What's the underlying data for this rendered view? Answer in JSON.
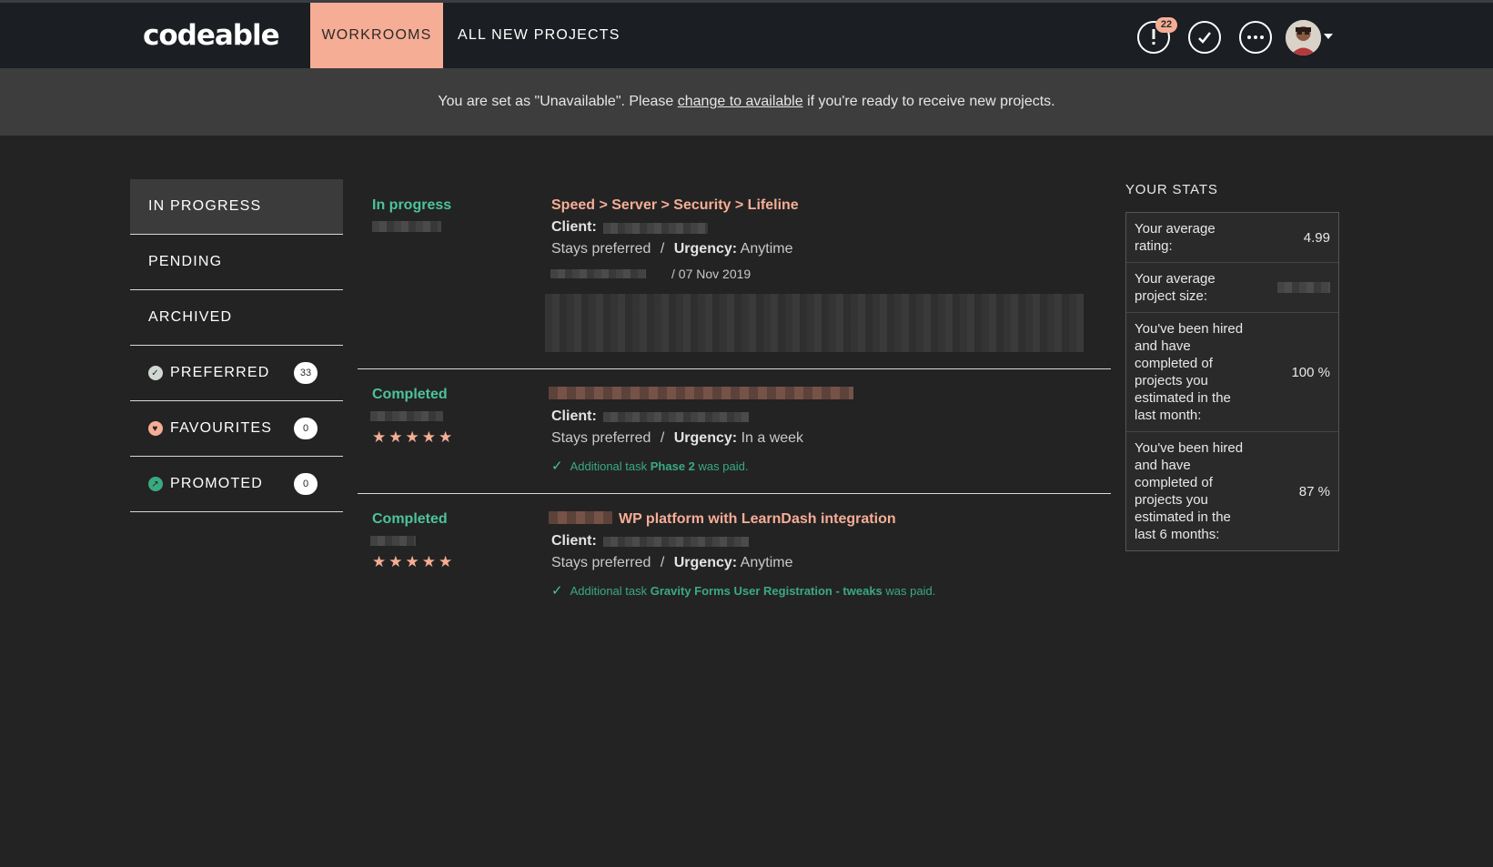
{
  "brand": {
    "logo": "codeable"
  },
  "nav": {
    "tabs": [
      {
        "label": "WORKROOMS",
        "active": true
      },
      {
        "label": "ALL NEW PROJECTS",
        "active": false
      }
    ],
    "notifications_count": "22"
  },
  "notice": {
    "text_before": "You are set as \"Unavailable\". Please ",
    "link_text": "change to available",
    "text_after": " if you're ready to receive new projects."
  },
  "sidebar": {
    "items": [
      {
        "label": "IN PROGRESS",
        "active": true
      },
      {
        "label": "PENDING"
      },
      {
        "label": "ARCHIVED"
      },
      {
        "label": "PREFERRED",
        "count": "33",
        "icon": "check-circle-icon"
      },
      {
        "label": "FAVOURITES",
        "count": "0",
        "icon": "heart-icon"
      },
      {
        "label": "PROMOTED",
        "count": "0",
        "icon": "arrow-up-right-icon"
      }
    ]
  },
  "projects": [
    {
      "status": "In progress",
      "title": "Speed > Server > Security > Lifeline",
      "client_label": "Client:",
      "preferred": "Stays preferred",
      "separator": "/",
      "urgency_label": "Urgency:",
      "urgency": "Anytime",
      "date": "/ 07 Nov 2019"
    },
    {
      "status": "Completed",
      "stars": "★★★★★",
      "client_label": "Client:",
      "preferred": "Stays preferred",
      "separator": "/",
      "urgency_label": "Urgency:",
      "urgency": "In a week",
      "paid_prefix": "Additional task ",
      "paid_task": "Phase 2",
      "paid_suffix": " was paid."
    },
    {
      "status": "Completed",
      "stars": "★★★★★",
      "title": "WP platform with LearnDash integration",
      "client_label": "Client:",
      "preferred": "Stays preferred",
      "separator": "/",
      "urgency_label": "Urgency:",
      "urgency": "Anytime",
      "paid_prefix": "Additional task ",
      "paid_task": "Gravity Forms User Registration - tweaks",
      "paid_suffix": " was paid."
    }
  ],
  "stats": {
    "title": "YOUR STATS",
    "rows": [
      {
        "label": "Your average rating:",
        "value": "4.99"
      },
      {
        "label": "Your average project size:",
        "value": ""
      },
      {
        "label": "You've been hired and have completed of projects you estimated in the last month:",
        "value": "100 %"
      },
      {
        "label": "You've been hired and have completed of projects you estimated in the last 6 months:",
        "value": "87 %"
      }
    ]
  },
  "colors": {
    "accent": "#f6ad96",
    "success": "#4cc39a",
    "background": "#232323",
    "nav": "#1b1e22"
  }
}
